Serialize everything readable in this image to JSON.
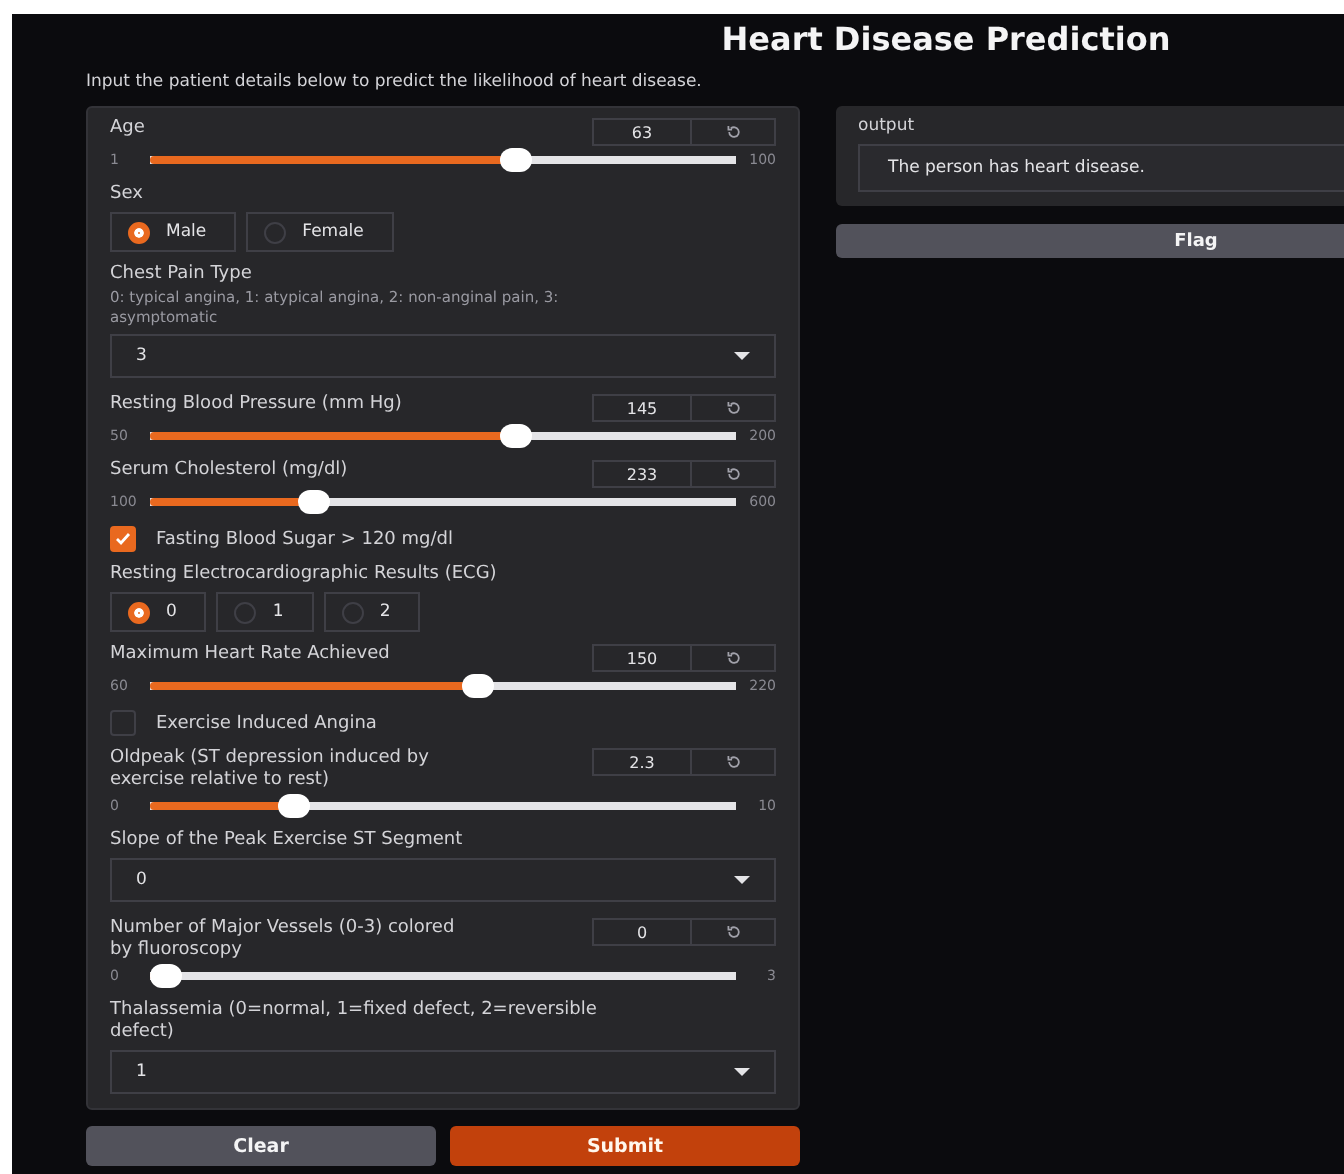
{
  "title": "Heart Disease Prediction",
  "description": "Input the patient details below to predict the likelihood of heart disease.",
  "inputs": [
    {
      "kind": "slider",
      "label": "Age",
      "value": "63",
      "min": "1",
      "max": "100",
      "level": 0.63
    },
    {
      "kind": "radio",
      "label": "Sex",
      "options": [
        {
          "label": "Male",
          "selected": true
        },
        {
          "label": "Female",
          "selected": false
        }
      ]
    },
    {
      "kind": "dropdown",
      "label": "Chest Pain Type",
      "info": "0: typical angina, 1: atypical angina, 2: non-anginal pain, 3: asymptomatic",
      "value": "3"
    },
    {
      "kind": "slider",
      "label": "Resting Blood Pressure (mm Hg)",
      "value": "145",
      "min": "50",
      "max": "200",
      "level": 0.633
    },
    {
      "kind": "slider",
      "label": "Serum Cholesterol (mg/dl)",
      "value": "233",
      "min": "100",
      "max": "600",
      "level": 0.266
    },
    {
      "kind": "checkbox",
      "label": "Fasting Blood Sugar > 120 mg/dl",
      "checked": true
    },
    {
      "kind": "radio",
      "label": "Resting Electrocardiographic Results (ECG)",
      "options": [
        {
          "label": "0",
          "selected": true
        },
        {
          "label": "1",
          "selected": false
        },
        {
          "label": "2",
          "selected": false
        }
      ]
    },
    {
      "kind": "slider",
      "label": "Maximum Heart Rate Achieved",
      "value": "150",
      "min": "60",
      "max": "220",
      "level": 0.5625
    },
    {
      "kind": "checkbox",
      "label": "Exercise Induced Angina",
      "checked": false
    },
    {
      "kind": "slider",
      "label": "Oldpeak (ST depression induced by exercise relative to rest)",
      "value": "2.3",
      "min": "0",
      "max": "10",
      "level": 0.23
    },
    {
      "kind": "dropdown",
      "label": "Slope of the Peak Exercise ST Segment",
      "value": "0"
    },
    {
      "kind": "slider",
      "label": "Number of Major Vessels (0-3) colored by fluoroscopy",
      "value": "0",
      "min": "0",
      "max": "3",
      "level": 0
    },
    {
      "kind": "dropdown",
      "label": "Thalassemia (0=normal, 1=fixed defect, 2=reversible defect)",
      "value": "1"
    }
  ],
  "output": {
    "label": "output",
    "value": "The person has heart disease."
  },
  "flag_button": "Flag",
  "actions": [
    {
      "label": "Clear",
      "kind": "secondary"
    },
    {
      "label": "Submit",
      "kind": "primary"
    }
  ]
}
